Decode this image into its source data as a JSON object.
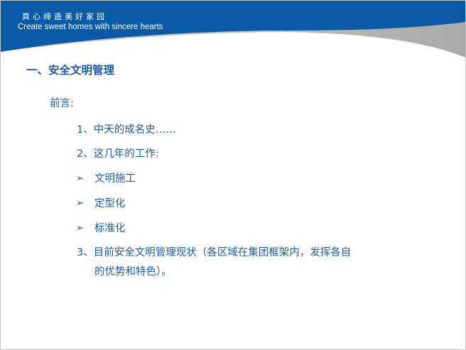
{
  "header": {
    "tagline_cn": "真心缔造美好家园",
    "tagline_en": "Create sweet homes with sincere hearts"
  },
  "section": {
    "title": "一、安全文明管理"
  },
  "content": {
    "intro": "前言:",
    "item1": "1、中天的成名史……",
    "item2": "2、这几年的工作:",
    "bullets": [
      "文明施工",
      "定型化",
      "标准化"
    ],
    "bullet_icon": "arrow-bullet-icon",
    "item3_line1": "3、目前安全文明管理现状（各区域在集团框架内，发挥各自",
    "item3_line2": "的优势和特色）。"
  },
  "colors": {
    "header_blue": "#0b5aa8",
    "text_blue": "#1f5aa6",
    "header_gray": "#b9b9b9"
  }
}
